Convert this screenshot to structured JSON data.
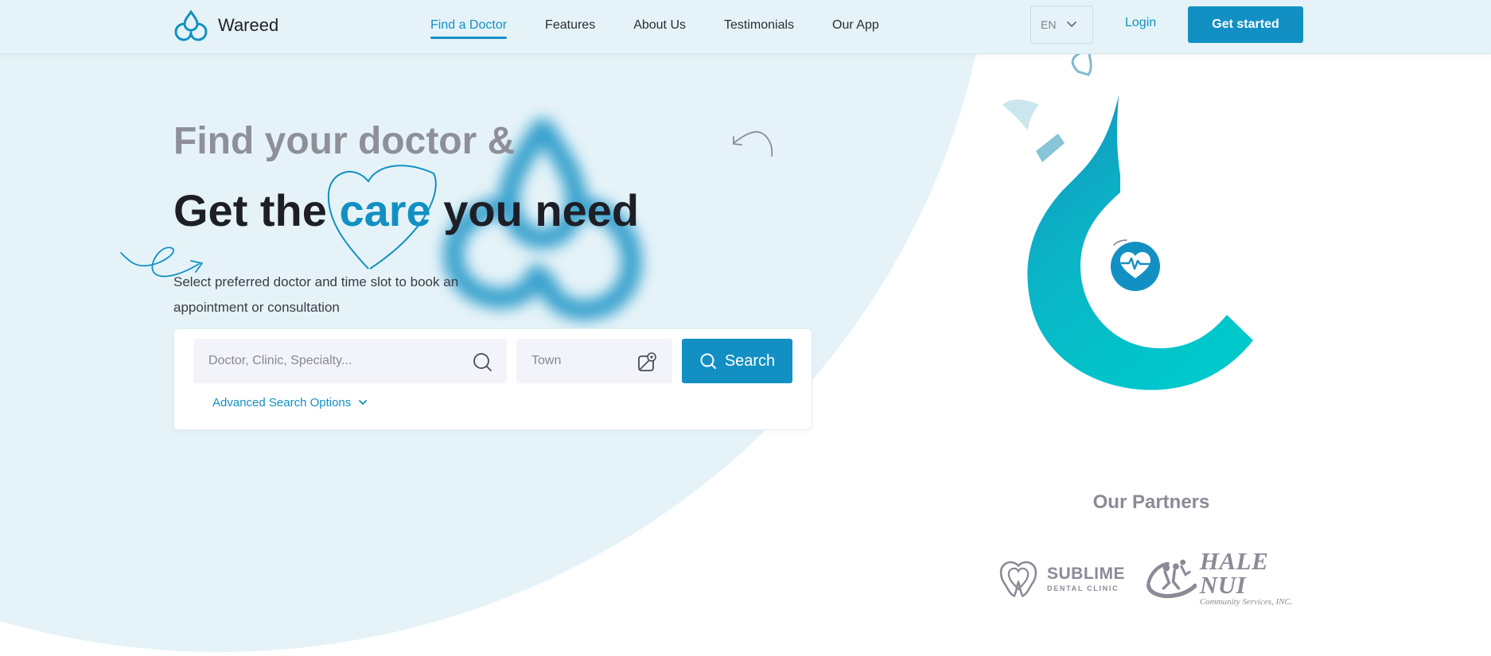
{
  "brand": {
    "name": "Wareed",
    "logo_icon": "water-drop-logo-icon"
  },
  "nav": {
    "links": [
      {
        "label": "Find a Doctor",
        "active": true
      },
      {
        "label": "Features",
        "active": false
      },
      {
        "label": "About Us",
        "active": false
      },
      {
        "label": "Testimonials",
        "active": false
      },
      {
        "label": "Our App",
        "active": false
      }
    ],
    "language": "EN",
    "login_label": "Login",
    "get_started_label": "Get started"
  },
  "hero": {
    "line1": "Find your doctor &",
    "line2_prefix": "Get the ",
    "line2_highlight": "care",
    "line2_suffix": " you need",
    "subtitle": "Select preferred doctor and time slot to book an appointment or consultation"
  },
  "search": {
    "doctor_placeholder": "Doctor, Clinic, Specialty...",
    "doctor_value": "",
    "town_placeholder": "Town",
    "town_value": "",
    "button_label": "Search",
    "advanced_label": "Advanced Search Options"
  },
  "partners": {
    "title": "Our Partners",
    "items": [
      {
        "name": "SUBLIME",
        "subtitle": "DENTAL CLINIC"
      },
      {
        "name": "HALE NUI",
        "subtitle": "Community Services, INC."
      }
    ]
  },
  "colors": {
    "accent": "#1290c3",
    "background_light": "#e5f3f8",
    "heading_gray": "#8e8f99",
    "heading_dark": "#1e1f26",
    "hook_teal": "#00c2c9"
  }
}
